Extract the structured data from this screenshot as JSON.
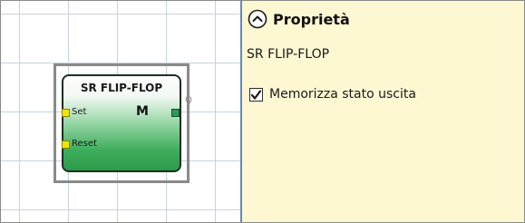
{
  "canvas": {
    "block": {
      "title": "SR FLIP-FLOP",
      "inputs": [
        {
          "label": "Set"
        },
        {
          "label": "Reset"
        }
      ],
      "mode_label": "M",
      "output_label": "Q"
    }
  },
  "properties": {
    "title": "Proprietà",
    "component_name": "SR FLIP-FLOP",
    "options": [
      {
        "label": "Memorizza stato uscita",
        "checked": true
      }
    ]
  },
  "colors": {
    "panel_bg": "#fdf7d2",
    "divider": "#5f8bc4",
    "block_green": "#2c9a4b",
    "input_pin": "#f4e400"
  },
  "icons": [
    "collapse-up-icon",
    "checkmark-icon"
  ]
}
